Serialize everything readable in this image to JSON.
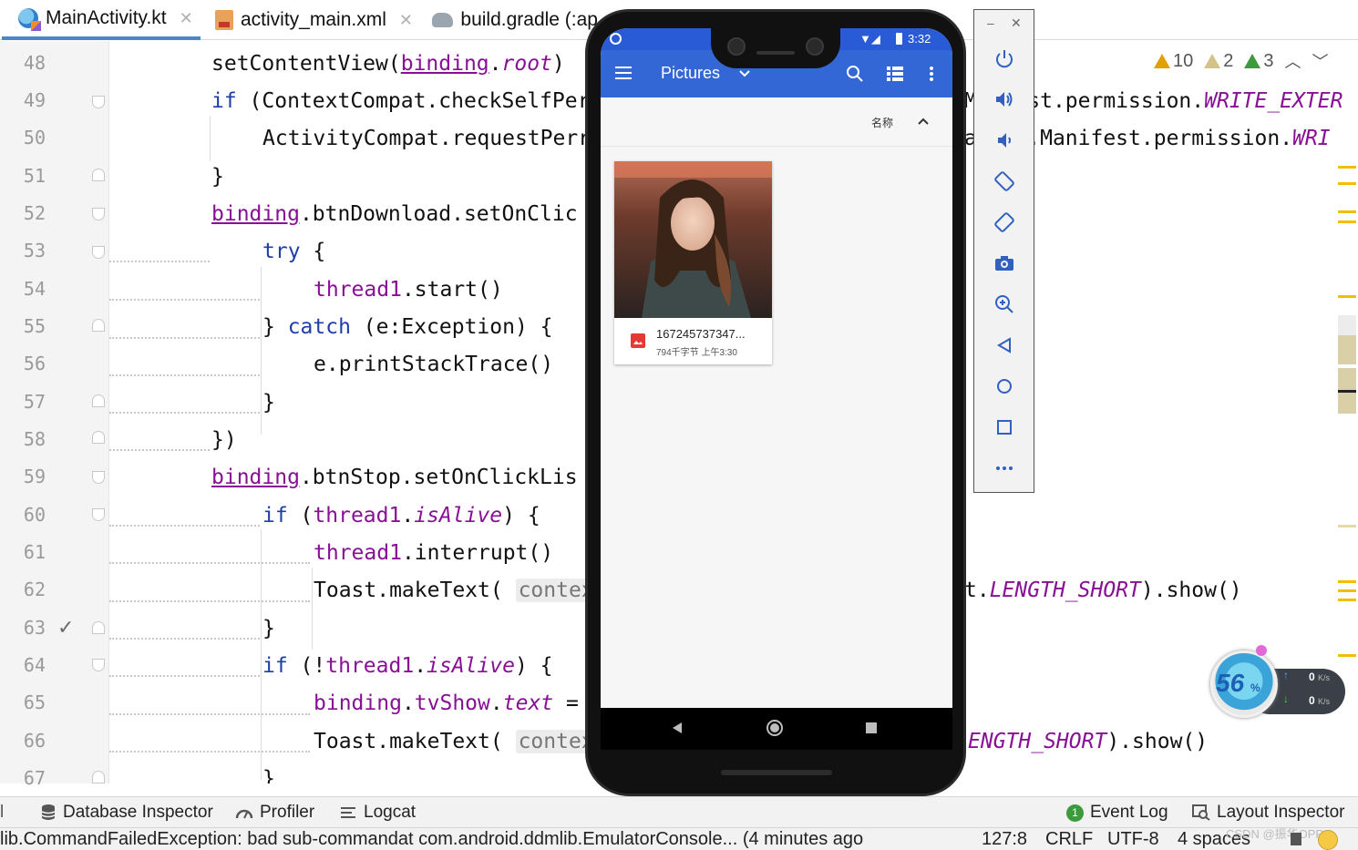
{
  "tabs": [
    {
      "label": "MainActivity.kt",
      "icon": "kotlin-file-icon",
      "active": true
    },
    {
      "label": "activity_main.xml",
      "icon": "xml-layout-icon",
      "active": false
    },
    {
      "label": "build.gradle (:ap",
      "icon": "gradle-icon",
      "active": false
    }
  ],
  "gutter": {
    "line_numbers": [
      "48",
      "49",
      "50",
      "51",
      "52",
      "53",
      "54",
      "55",
      "56",
      "57",
      "58",
      "59",
      "60",
      "61",
      "62",
      "63",
      "64",
      "65",
      "66",
      "67"
    ]
  },
  "code": {
    "l48": {
      "a": "setContentView(",
      "b": "binding",
      "c": ".",
      "d": "root",
      "e": ")"
    },
    "l49": {
      "a": "if",
      "b": " (ContextCompat.checkSelfPer"
    },
    "l50": {
      "a": "ActivityCompat.requestPerr"
    },
    "l51": {
      "a": "}"
    },
    "l52": {
      "a": "binding",
      "b": ".btnDownload.setOnClic"
    },
    "l53": {
      "a": "try",
      "b": " {"
    },
    "l54": {
      "a": "thread1",
      "b": ".start()"
    },
    "l55": {
      "a": "} ",
      "b": "catch",
      "c": " (e:Exception) {"
    },
    "l56": {
      "a": "e.printStackTrace()"
    },
    "l57": {
      "a": "}"
    },
    "l58": {
      "a": "})"
    },
    "l59": {
      "a": "binding",
      "b": ".btnStop.setOnClickLis"
    },
    "l60": {
      "a": "if",
      "b": " (",
      "c": "thread1",
      "d": ".",
      "e": "isAlive",
      "f": ") {"
    },
    "l61": {
      "a": "thread1",
      "b": ".interrupt()"
    },
    "l62": {
      "a": "Toast.makeText( ",
      "b": "context:"
    },
    "l63": {
      "a": "}"
    },
    "l64": {
      "a": "if",
      "b": " (!",
      "c": "thread1",
      "d": ".",
      "e": "isAlive",
      "f": ") {"
    },
    "l65": {
      "a": "binding",
      "b": ".",
      "c": "tvShow",
      "d": ".",
      "e": "text",
      "f": " ="
    },
    "l66": {
      "a": "Toast.makeText( ",
      "b": "context:"
    },
    "l67": {
      "a": "}"
    }
  },
  "code_right": {
    "l49": {
      "a": "M",
      "b": "est.permission.",
      "c": "WRITE_EXTER"
    },
    "l50": {
      "a": "a",
      "b": "d.Manifest.permission.",
      "c": "WRI"
    },
    "l62": {
      "a": "t.",
      "b": "LENGTH_SHORT",
      "c": ").show()"
    },
    "l66": {
      "a": "ENGTH_SHORT",
      "b": ").show()"
    }
  },
  "inspections": {
    "warnings": "10",
    "weak_warnings": "2",
    "typos": "3"
  },
  "phone": {
    "time": "3:32",
    "app_title": "Pictures",
    "sort_label": "名称",
    "file": {
      "name": "167245737347...",
      "meta": "794千字节 上午3:30"
    }
  },
  "speed_widget": {
    "percent": "56",
    "unit": "%",
    "up": "0",
    "down": "0",
    "rate_unit": "K/s"
  },
  "toolwindows": {
    "database_inspector": "Database Inspector",
    "profiler": "Profiler",
    "logcat": "Logcat",
    "event_log": "Event Log",
    "event_count": "1",
    "layout_inspector": "Layout Inspector"
  },
  "status": {
    "message": "lib.CommandFailedException: bad sub-commandat com.android.ddmlib.EmulatorConsole... (4 minutes ago",
    "position": "127:8",
    "line_sep": "CRLF",
    "encoding": "UTF-8",
    "indent": "4 spaces",
    "watermark": "CSDN @振华OPPO"
  },
  "colors": {
    "keyword": "#1f3fa8",
    "property": "#871094",
    "app_bar": "#3367d6",
    "warning": "#e0a100"
  }
}
